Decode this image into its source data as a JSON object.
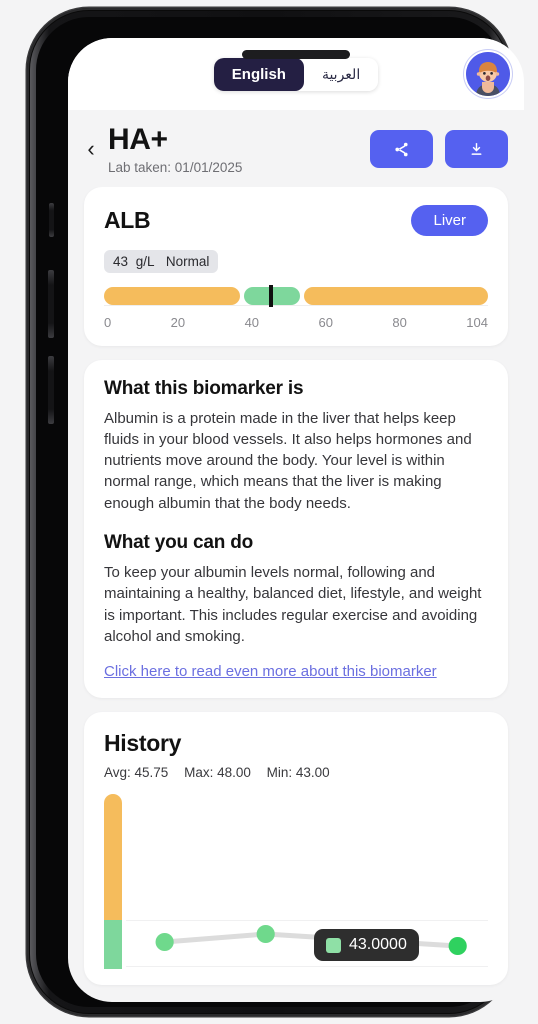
{
  "topbar": {
    "lang_en": "English",
    "lang_ar": "العربية",
    "avatar_name": "user-avatar"
  },
  "header": {
    "back_icon": "chevron-left-icon",
    "title": "HA+",
    "lab_taken": "Lab taken: 01/01/2025",
    "share_label": "share-icon",
    "download_label": "download-icon"
  },
  "biomarker": {
    "name": "ALB",
    "organ_badge": "Liver",
    "value": "43",
    "unit": "g/L",
    "status": "Normal",
    "ticks": [
      "0",
      "20",
      "40",
      "60",
      "80",
      "104"
    ],
    "colors": {
      "abnormal": "#f5bc5c",
      "normal": "#7ed79c",
      "marker": "#101010",
      "accent": "#5561f0"
    }
  },
  "info": {
    "title_1": "What this biomarker is",
    "body_1": "Albumin is a protein made in the liver that helps keep fluids in your blood vessels. It also helps hormones and nutrients move around the body. Your level is within normal range, which means that the liver is making enough albumin that the body needs.",
    "title_2": "What you can do",
    "body_2": "To keep your albumin levels normal, following and maintaining a healthy, balanced diet, lifestyle, and weight is important. This includes regular exercise and avoiding alcohol and smoking.",
    "link": "Click here to read even more about this biomarker"
  },
  "history": {
    "title": "History",
    "avg_label": "Avg: 45.75",
    "max_label": "Max: 48.00",
    "min_label": "Min: 43.00",
    "tooltip_value": "43.0000"
  },
  "chart_data": {
    "type": "line",
    "title": "History",
    "x": [
      1,
      2,
      3,
      4
    ],
    "values": [
      45.0,
      47.0,
      46.0,
      43.0
    ],
    "series": [
      {
        "name": "ALB",
        "values": [
          45.0,
          47.0,
          46.0,
          43.0
        ]
      }
    ],
    "stats": {
      "avg": 45.75,
      "max": 48.0,
      "min": 43.0
    },
    "normal_range": [
      35,
      52
    ],
    "ylim": [
      0,
      104
    ],
    "xlabel": "",
    "ylabel": "",
    "grid": true,
    "legend": "none",
    "point_color": "#6fd98c",
    "line_color": "#dcdcdc",
    "annotation": "43.0000"
  }
}
